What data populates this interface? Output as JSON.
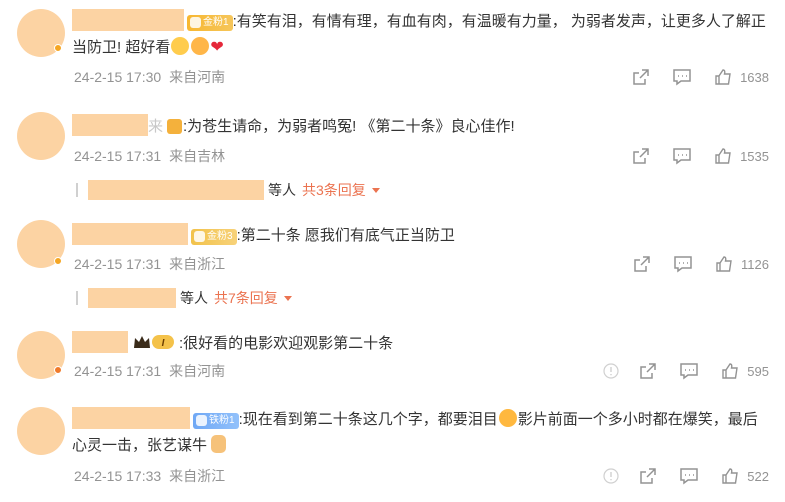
{
  "comments": [
    {
      "badge": "金粉1",
      "text": ":有笑有泪，有情有理，有血有肉，有温暖有力量，  为弱者发声，让更多人了解正当防卫! 超好看",
      "time": "24-2-15 17:30",
      "location": "来自河南",
      "likes": "1638"
    },
    {
      "name_tail": "来",
      "text": ":为苍生请命，为弱者鸣冤! 《第二十条》良心佳作!",
      "time": "24-2-15 17:31",
      "location": "来自吉林",
      "likes": "1535",
      "reply_people": "等人",
      "reply_link": "共3条回复"
    },
    {
      "badge": "金粉3",
      "text": ":第二十条 愿我们有底气正当防卫",
      "time": "24-2-15 17:31",
      "location": "来自浙江",
      "likes": "1126",
      "reply_people": "等人",
      "reply_link": "共7条回复"
    },
    {
      "vip_level": "I",
      "text": ":很好看的电影欢迎观影第二十条",
      "time": "24-2-15 17:31",
      "location": "来自河南",
      "likes": "595"
    },
    {
      "badge": "铁粉1",
      "text_a": ":现在看到第二十条这几个字，都要泪目",
      "text_b": "影片前面一个多小时都在爆笑，最后心灵一击，张艺谋牛",
      "time": "24-2-15 17:33",
      "location": "来自浙江",
      "likes": "522"
    }
  ],
  "icons": {
    "share": "share-icon",
    "comment": "comment-icon",
    "like": "like-icon",
    "report": "report-icon"
  },
  "colors": {
    "mask": "#fcd3a3",
    "accent": "#eb7350",
    "meta": "#939393"
  }
}
